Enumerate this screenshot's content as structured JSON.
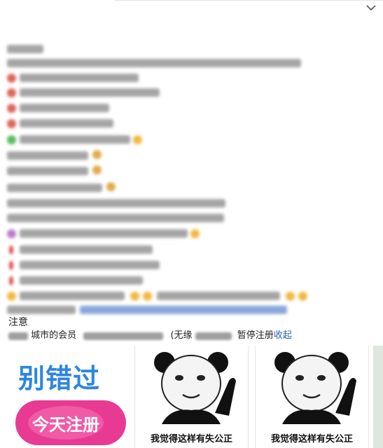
{
  "header": {
    "collapse_icon": "chevron-down-icon"
  },
  "post": {
    "notice_label": "注意",
    "members_line": {
      "segment_1": "城市的会员",
      "segment_2": "(无缘",
      "segment_3": "暂停注册",
      "collapse_link": "收起"
    }
  },
  "tiles": [
    {
      "kind": "ad",
      "headline": "别错过",
      "cta": "今天注册"
    },
    {
      "kind": "meme",
      "caption": "我觉得这样有失公正"
    },
    {
      "kind": "meme",
      "caption": "我觉得这样有失公正"
    }
  ],
  "colors": {
    "link": "#2a62b8",
    "ad_blue": "#2d86df",
    "ad_pink": "#e93a93"
  }
}
